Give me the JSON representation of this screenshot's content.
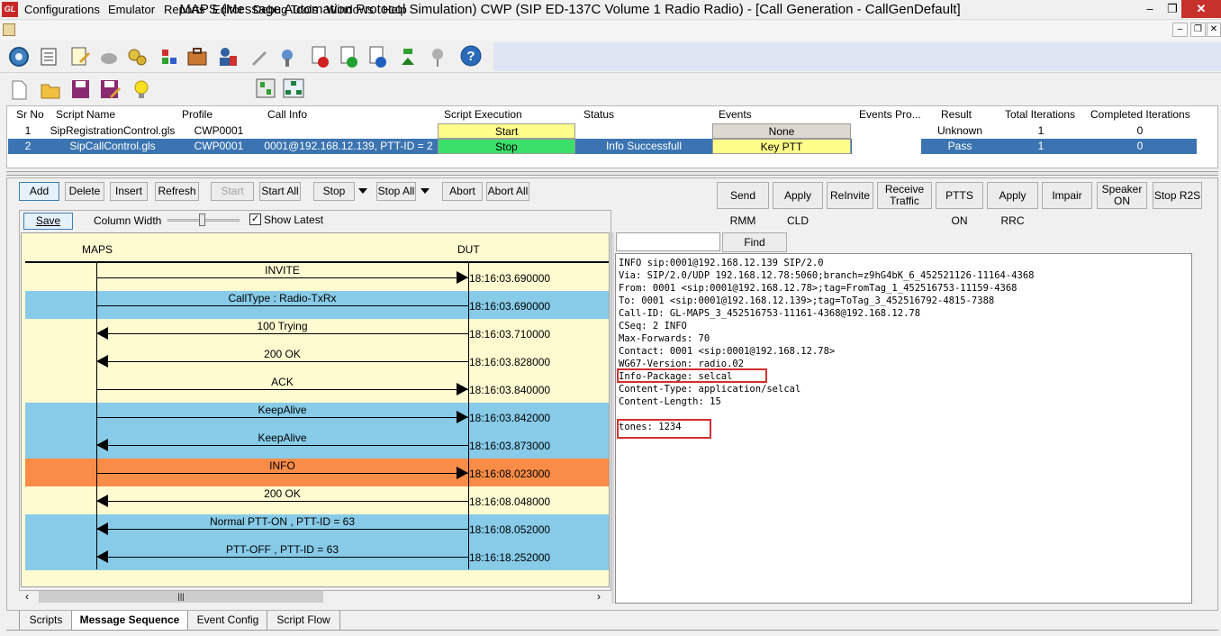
{
  "window": {
    "app_icon": "GL",
    "title": "MAPS (Message Automation Protocol Simulation) CWP (SIP ED-137C Volume 1 Radio Radio) - [Call Generation  - CallGenDefault]",
    "minimize": "–",
    "maximize": "❐",
    "close": "✕"
  },
  "menu": [
    "Configurations",
    "Emulator",
    "Reports",
    "Editor",
    "Debug Tools",
    "Windows",
    "Help"
  ],
  "mdi_controls": [
    "–",
    "❐",
    "✕"
  ],
  "script_table": {
    "headers": [
      "Sr No",
      "Script Name",
      "Profile",
      "Call Info",
      "Script Execution",
      "Status",
      "Events",
      "Events Pro...",
      "Result",
      "Total Iterations",
      "Completed Iterations"
    ],
    "rows": [
      {
        "sr": "1",
        "script": "SipRegistrationControl.gls",
        "profile": "CWP0001",
        "callinfo": "",
        "exec": "Start",
        "status": "",
        "events": "None",
        "eventspro": "",
        "result": "Unknown",
        "total": "1",
        "completed": "0"
      },
      {
        "sr": "2",
        "script": "SipCallControl.gls",
        "profile": "CWP0001",
        "callinfo": "0001@192.168.12.139, PTT-ID = 2",
        "exec": "Stop",
        "status": "Info Successfull",
        "events": "Key PTT",
        "eventspro": "",
        "result": "Pass",
        "total": "1",
        "completed": "0"
      }
    ]
  },
  "buttons": {
    "add": "Add",
    "delete": "Delete",
    "insert": "Insert",
    "refresh": "Refresh",
    "start": "Start",
    "start_all": "Start All",
    "stop": "Stop",
    "stop_all": "Stop All",
    "abort": "Abort",
    "abort_all": "Abort All",
    "send_rmm": "Send RMM",
    "apply_cld": "Apply CLD",
    "reinvite": "ReInvite",
    "receive_traffic_1": "Receive",
    "receive_traffic_2": "Traffic",
    "ptts_on": "PTTS ON",
    "apply_rrc": "Apply RRC",
    "impair": "Impair",
    "speaker_on_1": "Speaker",
    "speaker_on_2": "ON",
    "stop_r2s": "Stop R2S",
    "save": "Save",
    "find": "Find"
  },
  "ladder_options": {
    "column_width_label": "Column Width",
    "show_latest_label": "Show Latest",
    "show_latest_checked": true,
    "search_value": ""
  },
  "ladder": {
    "left_entity": "MAPS",
    "right_entity": "DUT",
    "messages": [
      {
        "label": "INVITE",
        "dir": "right",
        "time": "18:16:03.690000",
        "band": "yellow"
      },
      {
        "label": "CallType : Radio-TxRx",
        "dir": "none",
        "time": "18:16:03.690000",
        "band": "blue"
      },
      {
        "label": "100  Trying",
        "dir": "left",
        "time": "18:16:03.710000",
        "band": "yellow"
      },
      {
        "label": "200  OK",
        "dir": "left",
        "time": "18:16:03.828000",
        "band": "yellow"
      },
      {
        "label": "ACK",
        "dir": "right",
        "time": "18:16:03.840000",
        "band": "yellow"
      },
      {
        "label": "KeepAlive",
        "dir": "right",
        "time": "18:16:03.842000",
        "band": "blue"
      },
      {
        "label": "KeepAlive",
        "dir": "left",
        "time": "18:16:03.873000",
        "band": "blue"
      },
      {
        "label": "INFO",
        "dir": "right",
        "time": "18:16:08.023000",
        "band": "orange"
      },
      {
        "label": "200  OK",
        "dir": "left",
        "time": "18:16:08.048000",
        "band": "yellow"
      },
      {
        "label": "Normal PTT-ON , PTT-ID = 63",
        "dir": "left",
        "time": "18:16:08.052000",
        "band": "blue"
      },
      {
        "label": "PTT-OFF , PTT-ID = 63",
        "dir": "left",
        "time": "18:16:18.252000",
        "band": "blue"
      }
    ]
  },
  "detail_lines": [
    "INFO sip:0001@192.168.12.139 SIP/2.0",
    "Via: SIP/2.0/UDP 192.168.12.78:5060;branch=z9hG4bK_6_452521126-11164-4368",
    "From: 0001 <sip:0001@192.168.12.78>;tag=FromTag_1_452516753-11159-4368",
    "To: 0001 <sip:0001@192.168.12.139>;tag=ToTag_3_452516792-4815-7388",
    "Call-ID: GL-MAPS_3_452516753-11161-4368@192.168.12.78",
    "CSeq: 2 INFO",
    "Max-Forwards: 70",
    "Contact: 0001 <sip:0001@192.168.12.78>",
    "WG67-Version: radio.02",
    "Info-Package: selcal",
    "Content-Type: application/selcal",
    "Content-Length: 15",
    "",
    "tones: 1234"
  ],
  "tabs": [
    "Scripts",
    "Message Sequence",
    "Event Config",
    "Script Flow"
  ],
  "active_tab": "Message Sequence",
  "scrollbar": {
    "left": "‹",
    "right": "›",
    "grip": "|||"
  },
  "colors": {
    "yellow_band": "#fefbd1",
    "blue_band": "#87cbe8",
    "orange_band": "#f98c47",
    "selected_row": "#3b74b1",
    "start_cell": "#fffe8a",
    "stop_cell": "#3ae06a",
    "redbox": "#d32f2f"
  },
  "icons": [
    "gear-icon",
    "notebook-icon",
    "script-edit-icon",
    "cloud-icon",
    "cogs-icon",
    "network-icon",
    "briefcase-icon",
    "user-phone-icon",
    "wrench-icon",
    "tool-icon",
    "stop-script-icon",
    "continue-script-icon",
    "pause-script-icon",
    "step-icon",
    "debug-icon",
    "help-icon",
    "new-file-icon",
    "open-folder-icon",
    "save-icon",
    "save-as-icon",
    "lightbulb-icon",
    "tile-vertical-icon",
    "tile-tree-icon"
  ]
}
